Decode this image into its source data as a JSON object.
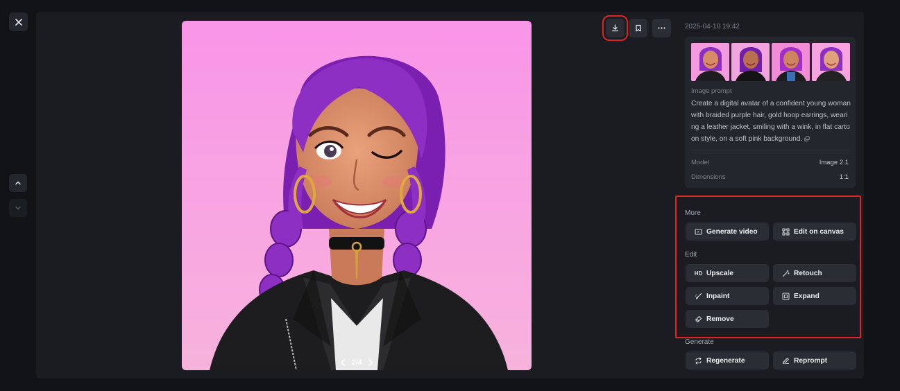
{
  "timestamp": "2025-04-10 19:42",
  "pager": {
    "text": "2/4"
  },
  "prompt": {
    "label": "Image prompt",
    "text": "Create a digital avatar of a confident young woman with braided purple hair, gold hoop earrings, wearing a leather jacket, smiling with a wink, in flat cartoon style, on a soft pink background."
  },
  "meta": [
    {
      "key": "Model",
      "value": "Image 2.1"
    },
    {
      "key": "Dimensions",
      "value": "1:1"
    }
  ],
  "sections": {
    "more": "More",
    "edit": "Edit",
    "generate": "Generate"
  },
  "buttons": {
    "generate_video": "Generate video",
    "edit_on_canvas": "Edit on canvas",
    "upscale": "Upscale",
    "upscale_icon_text": "HD",
    "retouch": "Retouch",
    "inpaint": "Inpaint",
    "expand": "Expand",
    "remove": "Remove",
    "regenerate": "Regenerate",
    "reprompt": "Reprompt"
  },
  "icons": {
    "close": "close-icon",
    "up": "chevron-up-icon",
    "down": "chevron-down-icon",
    "download": "download-icon",
    "bookmark": "bookmark-icon",
    "more": "more-horizontal-icon"
  },
  "colors": {
    "background": "#111317",
    "panel": "#1a1c21",
    "card": "#23262c",
    "button": "#2a2d33",
    "highlight": "#e02424",
    "image_bg": "#f8a0e4",
    "hair": "#8e2fc4"
  }
}
